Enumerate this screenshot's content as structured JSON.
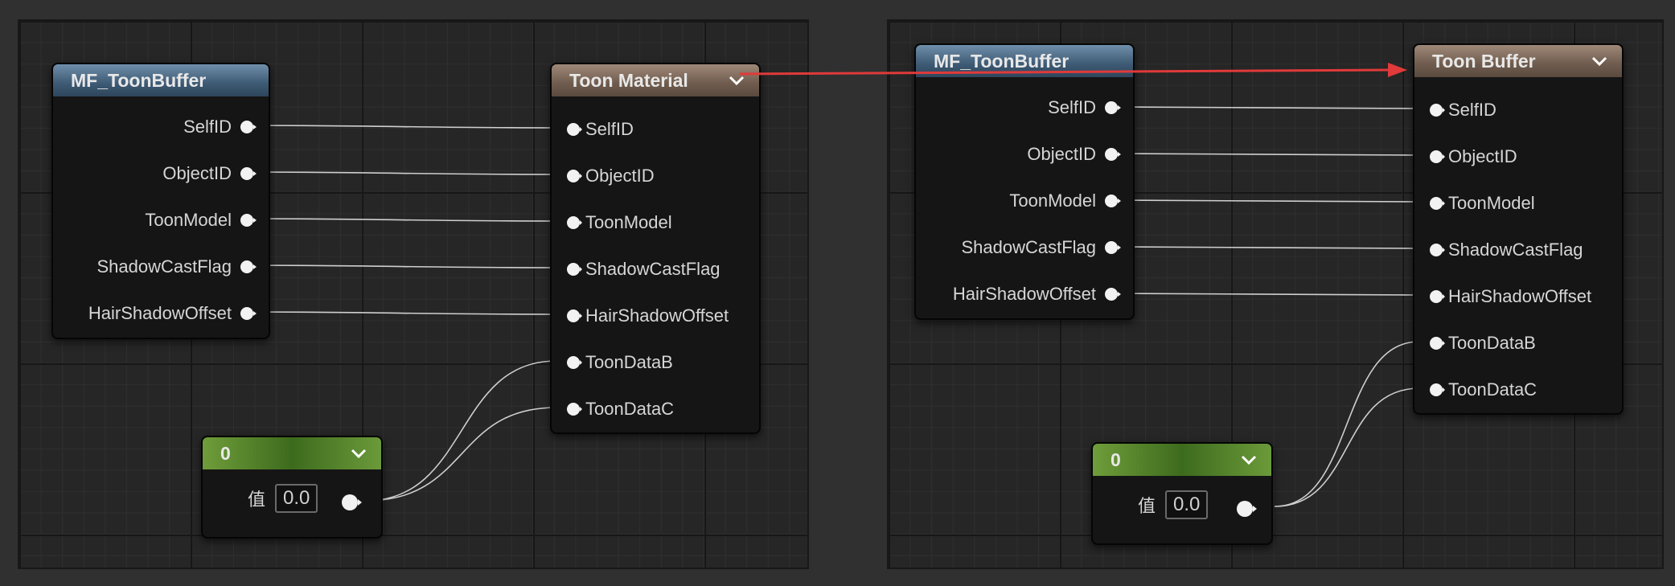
{
  "left_graph": {
    "source_node": {
      "title": "MF_ToonBuffer",
      "outputs": [
        "SelfID",
        "ObjectID",
        "ToonModel",
        "ShadowCastFlag",
        "HairShadowOffset"
      ]
    },
    "target_node": {
      "title": "Toon Material",
      "inputs": [
        "SelfID",
        "ObjectID",
        "ToonModel",
        "ShadowCastFlag",
        "HairShadowOffset",
        "ToonDataB",
        "ToonDataC"
      ]
    },
    "constant_node": {
      "title": "0",
      "value_label": "值",
      "value": "0.0"
    }
  },
  "right_graph": {
    "source_node": {
      "title": "MF_ToonBuffer",
      "outputs": [
        "SelfID",
        "ObjectID",
        "ToonModel",
        "ShadowCastFlag",
        "HairShadowOffset"
      ]
    },
    "target_node": {
      "title": "Toon Buffer",
      "inputs": [
        "SelfID",
        "ObjectID",
        "ToonModel",
        "ShadowCastFlag",
        "HairShadowOffset",
        "ToonDataB",
        "ToonDataC"
      ]
    },
    "constant_node": {
      "title": "0",
      "value_label": "值",
      "value": "0.0"
    }
  },
  "colors": {
    "arrow": "#e03a3a",
    "wire": "#cfcfcf"
  }
}
